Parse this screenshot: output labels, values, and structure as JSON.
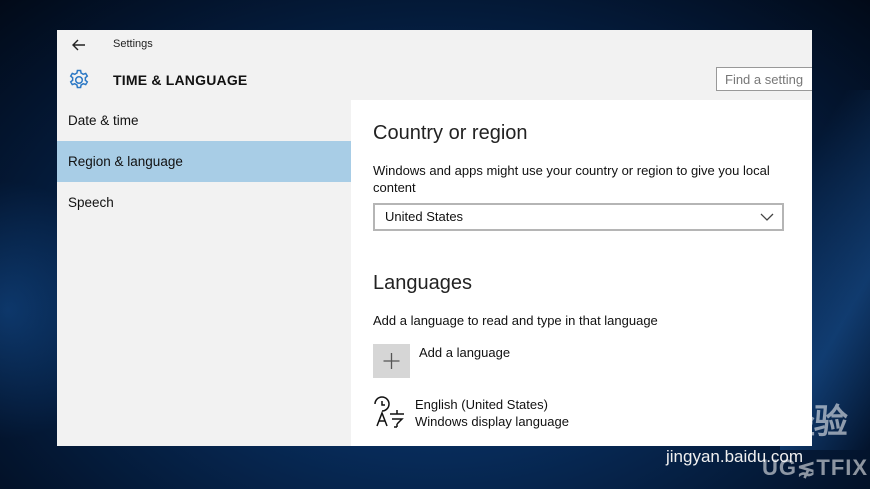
{
  "window": {
    "title": "Settings",
    "header_title": "TIME & LANGUAGE",
    "search_placeholder": "Find a setting"
  },
  "icons": {
    "back": "back-arrow-icon",
    "settings": "gear-icon",
    "chevron": "chevron-down-icon",
    "add": "plus-icon",
    "language": "language-icon"
  },
  "sidebar": {
    "items": [
      {
        "label": "Date & time"
      },
      {
        "label": "Region & language",
        "selected": true
      },
      {
        "label": "Speech"
      }
    ]
  },
  "region": {
    "heading": "Country or region",
    "description": "Windows and apps might use your country or region to give you local content",
    "selected_country": "United States"
  },
  "languages": {
    "heading": "Languages",
    "description": "Add a language to read and type in that language",
    "add_label": "Add a language",
    "items": [
      {
        "name": "English (United States)",
        "subtitle": "Windows display language"
      }
    ]
  },
  "watermarks": {
    "baidu": "Baidu 经验",
    "site": "jingyan.baidu.com",
    "ugetfix": "UG⋦TFIX"
  },
  "colors": {
    "selected_nav": "#a8cde6",
    "panel_bg": "#f2f2f2",
    "accent_icon": "#2b78c5"
  }
}
